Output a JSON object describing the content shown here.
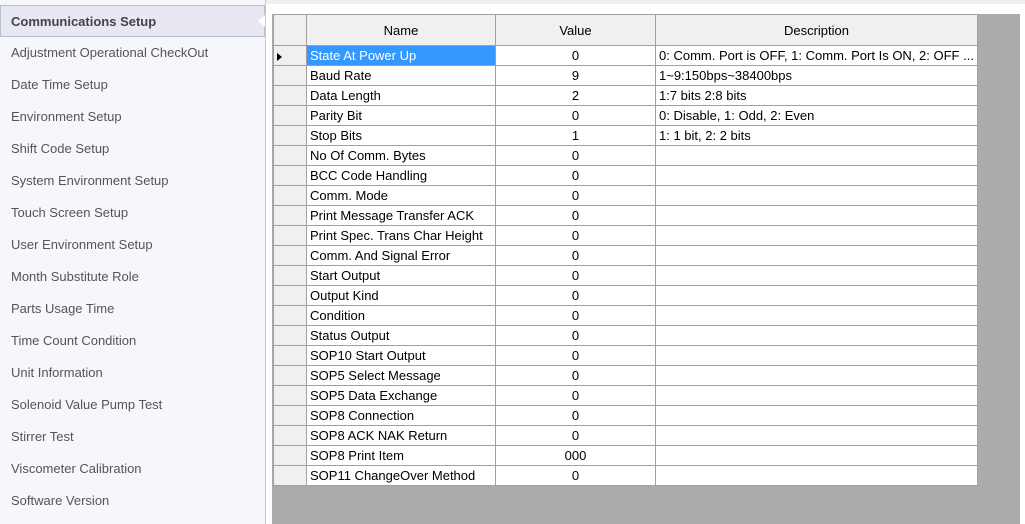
{
  "sidebar": {
    "items": [
      {
        "label": "Communications Setup",
        "selected": true
      },
      {
        "label": "Adjustment Operational CheckOut"
      },
      {
        "label": "Date Time Setup"
      },
      {
        "label": "Environment Setup"
      },
      {
        "label": "Shift Code Setup"
      },
      {
        "label": "System Environment Setup"
      },
      {
        "label": "Touch Screen Setup"
      },
      {
        "label": "User Environment Setup"
      },
      {
        "label": "Month Substitute Role"
      },
      {
        "label": "Parts Usage Time"
      },
      {
        "label": "Time Count Condition"
      },
      {
        "label": "Unit Information"
      },
      {
        "label": "Solenoid Value Pump Test"
      },
      {
        "label": "Stirrer Test"
      },
      {
        "label": "Viscometer Calibration"
      },
      {
        "label": "Software Version"
      }
    ]
  },
  "grid": {
    "columns": [
      "Name",
      "Value",
      "Description"
    ],
    "rows": [
      {
        "name": "State At Power Up",
        "value": "0",
        "description": "0: Comm. Port is OFF, 1: Comm. Port Is ON, 2: OFF ..."
      },
      {
        "name": "Baud Rate",
        "value": "9",
        "description": "1~9:150bps~38400bps"
      },
      {
        "name": "Data Length",
        "value": "2",
        "description": "1:7 bits 2:8 bits"
      },
      {
        "name": "Parity Bit",
        "value": "0",
        "description": "0: Disable, 1: Odd, 2: Even"
      },
      {
        "name": "Stop Bits",
        "value": "1",
        "description": "1: 1 bit, 2: 2 bits"
      },
      {
        "name": "No Of Comm. Bytes",
        "value": "0",
        "description": ""
      },
      {
        "name": "BCC Code Handling",
        "value": "0",
        "description": ""
      },
      {
        "name": "Comm. Mode",
        "value": "0",
        "description": ""
      },
      {
        "name": "Print Message Transfer ACK",
        "value": "0",
        "description": ""
      },
      {
        "name": "Print Spec. Trans Char Height",
        "value": "0",
        "description": ""
      },
      {
        "name": "Comm. And Signal Error",
        "value": "0",
        "description": ""
      },
      {
        "name": "Start Output",
        "value": "0",
        "description": ""
      },
      {
        "name": "Output Kind",
        "value": "0",
        "description": ""
      },
      {
        "name": "Condition",
        "value": "0",
        "description": ""
      },
      {
        "name": "Status Output",
        "value": "0",
        "description": ""
      },
      {
        "name": "SOP10 Start Output",
        "value": "0",
        "description": ""
      },
      {
        "name": "SOP5 Select Message",
        "value": "0",
        "description": ""
      },
      {
        "name": "SOP5 Data Exchange",
        "value": "0",
        "description": ""
      },
      {
        "name": "SOP8 Connection",
        "value": "0",
        "description": ""
      },
      {
        "name": "SOP8 ACK NAK Return",
        "value": "0",
        "description": ""
      },
      {
        "name": "SOP8 Print Item",
        "value": "000",
        "description": ""
      },
      {
        "name": "SOP11 ChangeOver Method",
        "value": "0",
        "description": ""
      }
    ]
  }
}
